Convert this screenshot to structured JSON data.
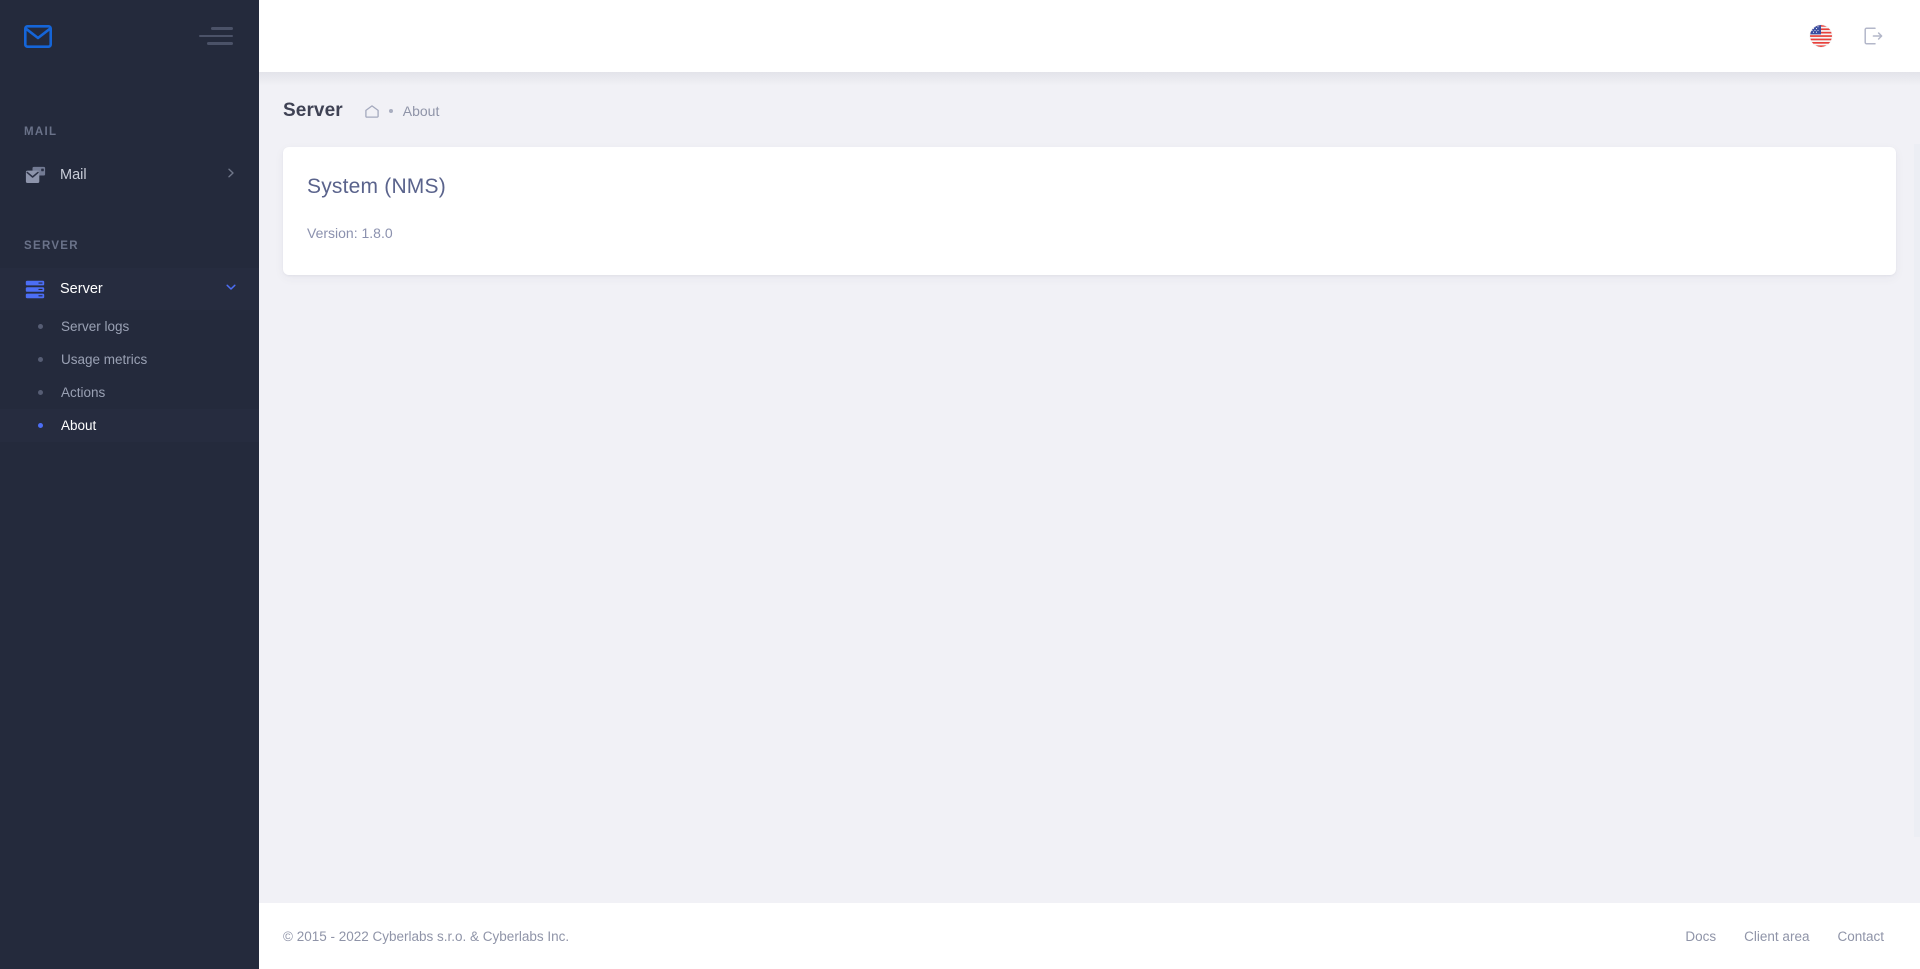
{
  "brand": {
    "logo_icon": "envelope-icon",
    "menu_icon": "hamburger-icon"
  },
  "sidebar": {
    "groups": [
      {
        "title": "MAIL",
        "items": [
          {
            "label": "Mail",
            "icon": "mail-stack-icon",
            "chevron": "chevron-right-icon",
            "active": false,
            "subitems": []
          }
        ]
      },
      {
        "title": "SERVER",
        "items": [
          {
            "label": "Server",
            "icon": "server-rack-icon",
            "chevron": "chevron-down-icon",
            "active": true,
            "subitems": [
              {
                "label": "Server logs",
                "active": false
              },
              {
                "label": "Usage metrics",
                "active": false
              },
              {
                "label": "Actions",
                "active": false
              },
              {
                "label": "About",
                "active": true
              }
            ]
          }
        ]
      }
    ]
  },
  "topbar": {
    "language_icon": "us-flag-icon",
    "logout_icon": "logout-icon"
  },
  "page": {
    "title": "Server",
    "breadcrumb": {
      "home_icon": "home-icon",
      "current": "About"
    }
  },
  "card": {
    "title": "System (NMS)",
    "version": "Version: 1.8.0"
  },
  "footer": {
    "copyright": "© 2015 - 2022 Cyberlabs s.r.o. & Cyberlabs Inc.",
    "links": [
      {
        "label": "Docs"
      },
      {
        "label": "Client area"
      },
      {
        "label": "Contact"
      }
    ]
  },
  "colors": {
    "sidebar_bg": "#242a3c",
    "sidebar_active": "#262c3f",
    "accent": "#4c6ef5",
    "logo_blue": "#1565d8",
    "content_bg": "#f1f1f6",
    "card_title": "#5a638c",
    "muted_text": "#8f94a8"
  }
}
